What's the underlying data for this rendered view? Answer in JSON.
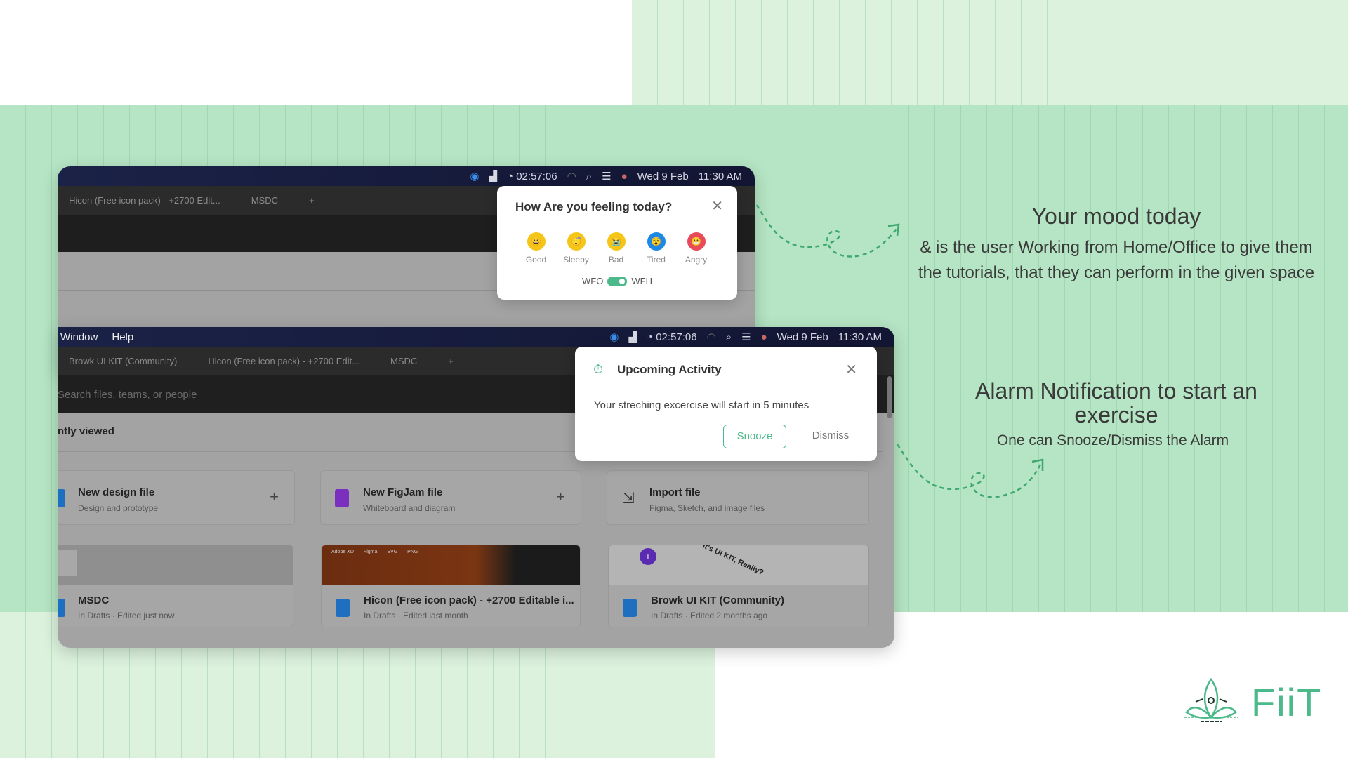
{
  "back_window": {
    "menubar": {
      "timer": "02:57:06",
      "date": "Wed 9 Feb",
      "time": "11:30 AM"
    },
    "tabs": [
      "Hicon (Free icon pack) - +2700 Edit...",
      "MSDC",
      "+"
    ]
  },
  "mood_popup": {
    "title": "How Are you feeling today?",
    "moods": [
      {
        "label": "Good",
        "icon": "grinning-face",
        "color": "#f5c518"
      },
      {
        "label": "Sleepy",
        "icon": "sleepy-face",
        "color": "#f5c518"
      },
      {
        "label": "Bad",
        "icon": "crying-face",
        "color": "#f5c518"
      },
      {
        "label": "Tired",
        "icon": "tired-face",
        "color": "#1e88e5"
      },
      {
        "label": "Angry",
        "icon": "angry-face",
        "color": "#e94a5a"
      }
    ],
    "toggle_left": "WFO",
    "toggle_right": "WFH",
    "toggle_on": true,
    "accent": "#4cb98a"
  },
  "front_window": {
    "menubar": {
      "menus": [
        "Window",
        "Help"
      ],
      "timer": "02:57:06",
      "date": "Wed 9 Feb",
      "time": "11:30 AM"
    },
    "tabs": [
      "Browk UI KIT (Community)",
      "Hicon (Free icon pack) - +2700 Edit...",
      "MSDC",
      "+"
    ],
    "search_placeholder": "Search files, teams, or people",
    "section": "ntly viewed",
    "actions": [
      {
        "title": "New design file",
        "sub": "Design and prototype"
      },
      {
        "title": "New FigJam file",
        "sub": "Whiteboard and diagram"
      },
      {
        "title": "Import file",
        "sub": "Figma, Sketch, and image files"
      }
    ],
    "files": [
      {
        "title": "MSDC",
        "sub": "In Drafts · Edited just now"
      },
      {
        "title": "Hicon (Free icon pack) - +2700 Editable i...",
        "sub": "In Drafts · Edited last month",
        "thumb_labels": [
          "Adobe XD",
          "Figma",
          "SVG",
          "PNG"
        ]
      },
      {
        "title": "Browk UI KIT (Community)",
        "sub": "In Drafts · Edited 2 months ago",
        "thumb_text": "It's UI KIT, Really?"
      }
    ]
  },
  "alarm_popup": {
    "title": "Upcoming Activity",
    "message": "Your streching excercise will start in 5 minutes",
    "snooze": "Snooze",
    "dismiss": "Dismiss"
  },
  "info": {
    "mood_heading": "Your mood today",
    "mood_body": "& is the user Working from Home/Office to give them the tutorials, that they can perform in the given space",
    "alarm_heading": "Alarm Notification to start an exercise",
    "alarm_body": "One can Snooze/Dismiss the Alarm"
  },
  "logo": {
    "text": "FiiT",
    "color": "#4cb98a"
  }
}
